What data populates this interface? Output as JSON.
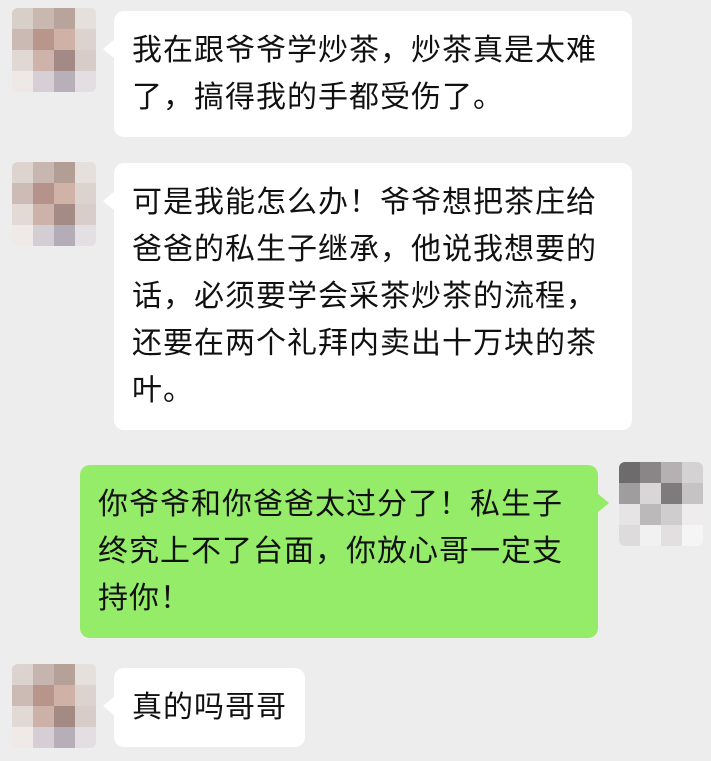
{
  "messages": [
    {
      "side": "incoming",
      "text": "我在跟爷爷学炒茶，炒茶真是太难了，搞得我的手都受伤了。"
    },
    {
      "side": "incoming",
      "text": "可是我能怎么办！爷爷想把茶庄给爸爸的私生子继承，他说我想要的话，必须要学会采茶炒茶的流程，还要在两个礼拜内卖出十万块的茶叶。"
    },
    {
      "side": "outgoing",
      "text": "你爷爷和你爸爸太过分了！私生子终究上不了台面，你放心哥一定支持你！"
    },
    {
      "side": "incoming",
      "text": "真的吗哥哥"
    }
  ],
  "avatars": {
    "contact": "pixelated-contact-avatar",
    "self": "pixelated-self-avatar"
  },
  "colors": {
    "background": "#ededed",
    "incoming_bubble": "#ffffff",
    "outgoing_bubble": "#95ec69",
    "text": "#111111"
  }
}
